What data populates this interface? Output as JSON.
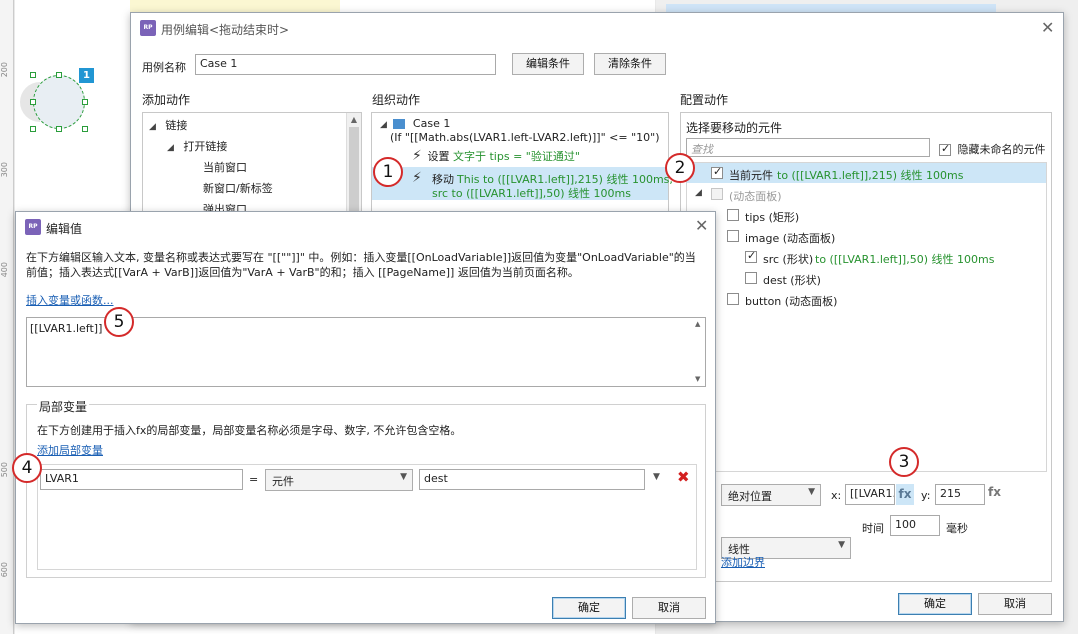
{
  "canvas": {
    "ruler_ticks": [
      "200",
      "300",
      "400",
      "500",
      "600"
    ],
    "shape_badge": "1"
  },
  "case_dialog": {
    "title": "用例编辑<拖动结束时>",
    "case_name_label": "用例名称",
    "case_name_value": "Case 1",
    "edit_condition_label": "编辑条件",
    "clear_condition_label": "清除条件",
    "add_action": {
      "header": "添加动作",
      "items": [
        "链接",
        "打开链接",
        "当前窗口",
        "新窗口/新标签",
        "弹出窗口"
      ]
    },
    "organize_action": {
      "header": "组织动作",
      "case_title": "Case 1",
      "case_condition": "(If \"[[Math.abs(LVAR1.left-LVAR2.left)]]\" <= \"10\")",
      "set_action": "设置",
      "set_detail": "文字于 tips = \"验证通过\"",
      "move_action": "移动",
      "move_detail_1": "This to ([[LVAR1.left]],215) 线性 100ms,",
      "move_detail_2": "src to ([[LVAR1.left]],50) 线性 100ms"
    },
    "config_action": {
      "header": "配置动作",
      "select_label": "选择要移动的元件",
      "search_placeholder": "查找",
      "hide_unnamed_label": "隐藏未命名的元件",
      "tree": [
        {
          "label": "当前元件",
          "detail": "to ([[LVAR1.left]],215) 线性 100ms",
          "checked": true
        },
        {
          "label": "(动态面板)",
          "detail": "",
          "checked": false
        },
        {
          "label": "tips (矩形)",
          "detail": "",
          "checked": false
        },
        {
          "label": "image (动态面板)",
          "detail": "",
          "checked": false
        },
        {
          "label": "src (形状)",
          "detail": "to ([[LVAR1.left]],50) 线性 100ms",
          "checked": true
        },
        {
          "label": "dest (形状)",
          "detail": "",
          "checked": false
        },
        {
          "label": "button (动态面板)",
          "detail": "",
          "checked": false
        }
      ],
      "position_mode": "绝对位置",
      "x_label": "x:",
      "x_value": "[[LVAR1.",
      "y_label": "y:",
      "y_value": "215",
      "fx_label": "fx",
      "easing": "线性",
      "time_label": "时间",
      "time_value": "100",
      "ms_label": "毫秒",
      "add_boundary_label": "添加边界"
    },
    "ok_label": "确定",
    "cancel_label": "取消"
  },
  "edit_value_dialog": {
    "title": "编辑值",
    "description": "在下方编辑区输入文本, 变量名称或表达式要写在 \"[[\"\"]]\" 中。例如：插入变量[[OnLoadVariable]]返回值为变量\"OnLoadVariable\"的当前值；插入表达式[[VarA + VarB]]返回值为\"VarA + VarB\"的和；插入 [[PageName]] 返回值为当前页面名称。",
    "insert_link": "插入变量或函数...",
    "editor_value": "[[LVAR1.left]]",
    "local_vars_header": "局部变量",
    "local_vars_desc": "在下方创建用于插入fx的局部变量，局部变量名称必须是字母、数字, 不允许包含空格。",
    "add_local_var_link": "添加局部变量",
    "var_name": "LVAR1",
    "equals": "=",
    "var_type": "元件",
    "var_target": "dest",
    "ok_label": "确定",
    "cancel_label": "取消"
  },
  "callouts": [
    "1",
    "2",
    "3",
    "4",
    "5"
  ],
  "colors": {
    "accent_green": "#27922f",
    "selection_blue": "#cde6f7",
    "callout_red": "#d42a2a",
    "delete_red": "#d32020"
  }
}
